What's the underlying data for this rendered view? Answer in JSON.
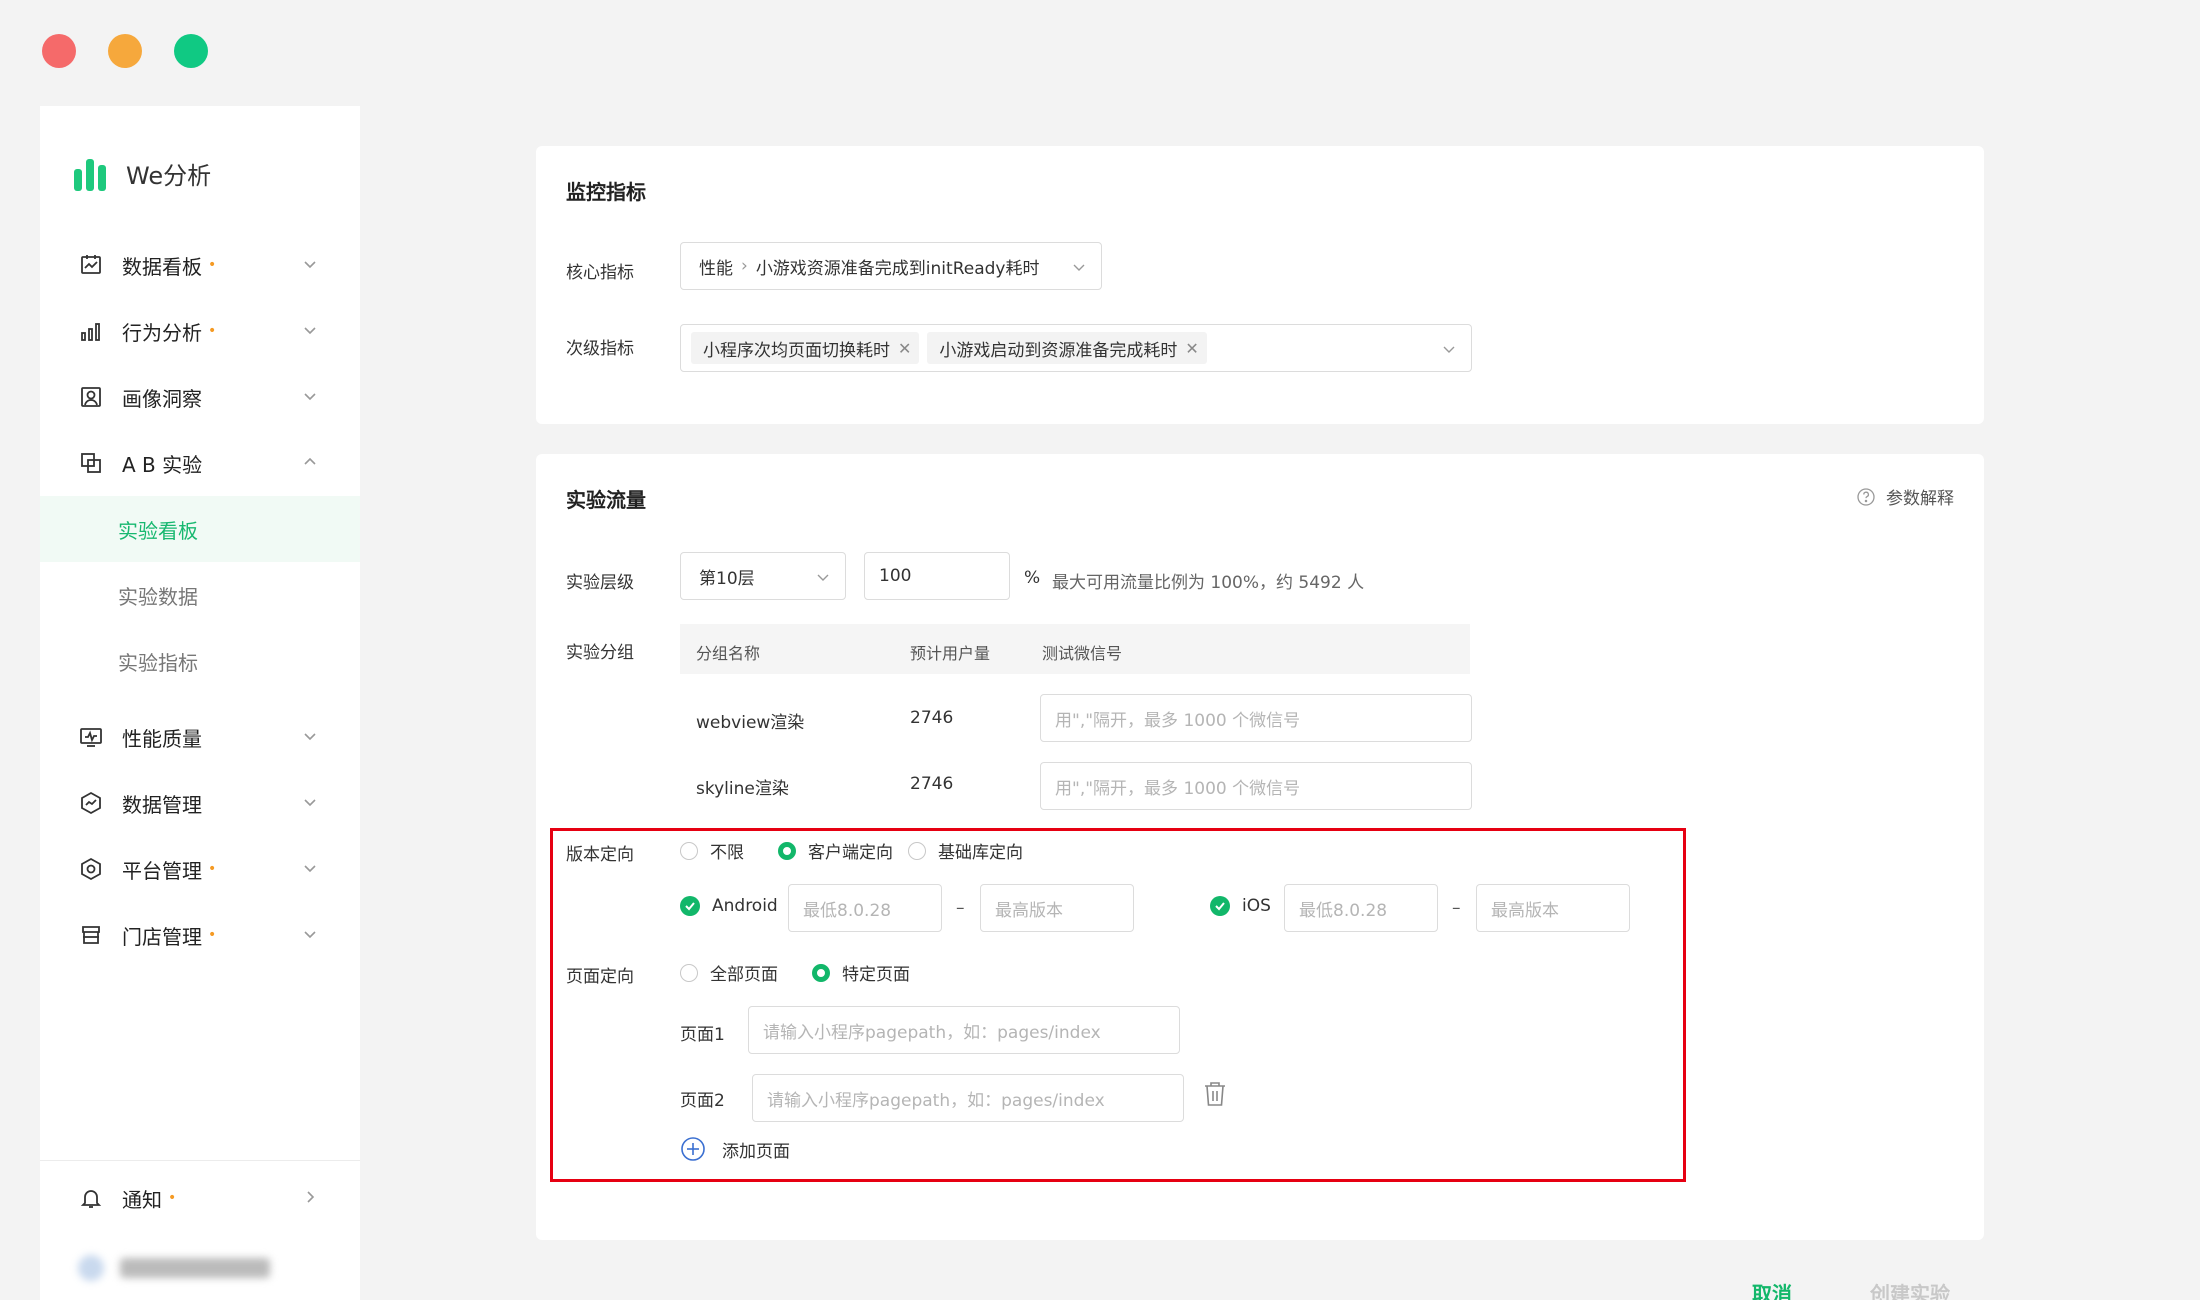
{
  "app": {
    "logo_text": "We分析",
    "brand_color": "#1ec97d",
    "accent_color": "#12b76a"
  },
  "sidebar": {
    "items": [
      {
        "label": "数据看板",
        "icon": "dashboard-icon",
        "dot": "•",
        "chevron": "down"
      },
      {
        "label": "行为分析",
        "icon": "bar-chart-icon",
        "dot": "•",
        "chevron": "down"
      },
      {
        "label": "画像洞察",
        "icon": "portrait-icon",
        "dot": "",
        "chevron": "down"
      },
      {
        "label": "A B 实验",
        "icon": "ab-test-icon",
        "dot": "",
        "chevron": "up"
      },
      {
        "label": "性能质量",
        "icon": "monitor-icon",
        "dot": "",
        "chevron": "down"
      },
      {
        "label": "数据管理",
        "icon": "data-manage-icon",
        "dot": "",
        "chevron": "down"
      },
      {
        "label": "平台管理",
        "icon": "settings-hex-icon",
        "dot": "•",
        "chevron": "down"
      },
      {
        "label": "门店管理",
        "icon": "store-icon",
        "dot": "•",
        "chevron": "down"
      }
    ],
    "sub_items": [
      {
        "label": "实验看板",
        "active": true
      },
      {
        "label": "实验数据",
        "active": false
      },
      {
        "label": "实验指标",
        "active": false
      }
    ],
    "bottom": {
      "notify_label": "通知",
      "notify_dot": "•"
    }
  },
  "monitor": {
    "title": "监控指标",
    "core_label": "核心指标",
    "core_path_1": "性能",
    "core_path_2": "小游戏资源准备完成到initReady耗时",
    "secondary_label": "次级指标",
    "secondary_tags": [
      "小程序次均页面切换耗时",
      "小游戏启动到资源准备完成耗时"
    ]
  },
  "traffic": {
    "title": "实验流量",
    "help_label": "参数解释",
    "layer_label": "实验层级",
    "layer_value": "第10层",
    "percent_value": "100",
    "percent_sign": "%",
    "percent_hint": "最大可用流量比例为 100%，约 5492 人",
    "group_label": "实验分组",
    "table_headers": [
      "分组名称",
      "预计用户量",
      "测试微信号"
    ],
    "groups": [
      {
        "name": "webview渲染",
        "users": "2746",
        "placeholder": "用\",\"隔开，最多 1000 个微信号"
      },
      {
        "name": "skyline渲染",
        "users": "2746",
        "placeholder": "用\",\"隔开，最多 1000 个微信号"
      }
    ],
    "version_label": "版本定向",
    "version_options": [
      {
        "label": "不限",
        "selected": false
      },
      {
        "label": "客户端定向",
        "selected": true
      },
      {
        "label": "基础库定向",
        "selected": false
      }
    ],
    "android_label": "Android",
    "ios_label": "iOS",
    "min_placeholder": "最低8.0.28",
    "max_placeholder": "最高版本",
    "range_dash": "–",
    "page_label": "页面定向",
    "page_options": [
      {
        "label": "全部页面",
        "selected": false
      },
      {
        "label": "特定页面",
        "selected": true
      }
    ],
    "pages": [
      {
        "label": "页面1",
        "placeholder": "请输入小程序pagepath，如：pages/index"
      },
      {
        "label": "页面2",
        "placeholder": "请输入小程序pagepath，如：pages/index"
      }
    ],
    "add_page_label": "添加页面"
  },
  "footer": {
    "cancel_label": "取消",
    "create_label": "创建实验"
  }
}
